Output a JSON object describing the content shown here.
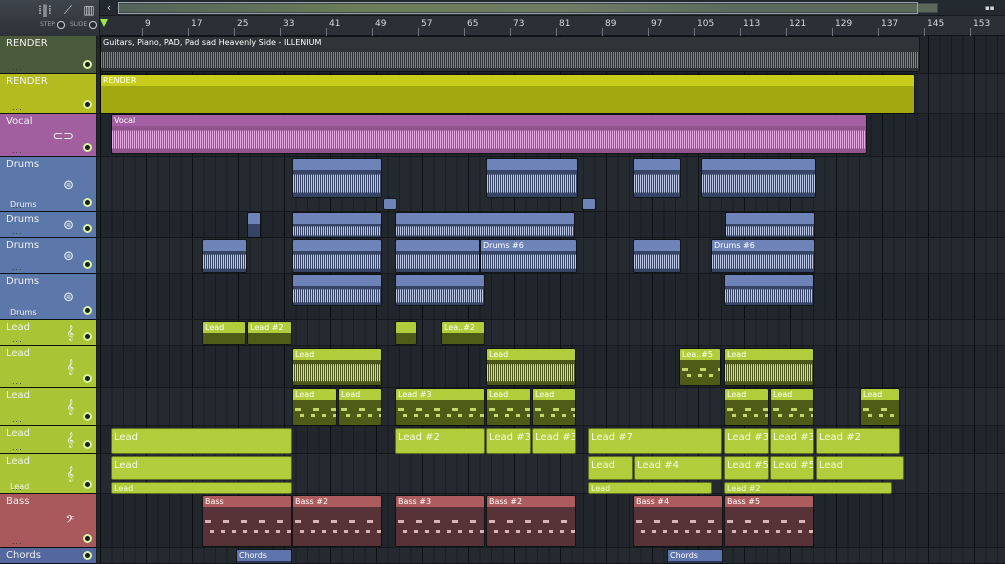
{
  "toolbar": {
    "step_label": "STEP",
    "slide_label": "SLIDE"
  },
  "ruler": {
    "ticks": [
      "9",
      "17",
      "25",
      "33",
      "41",
      "49",
      "57",
      "65",
      "73",
      "81",
      "89",
      "97",
      "105",
      "113",
      "121",
      "129",
      "137",
      "145",
      "153"
    ]
  },
  "tracks": [
    {
      "id": "render1",
      "label": "RENDER",
      "style": "render1"
    },
    {
      "id": "render2",
      "label": "RENDER",
      "style": "render2"
    },
    {
      "id": "vocal",
      "label": "Vocal",
      "style": "vocal",
      "icon": "lips-icon"
    },
    {
      "id": "drums1",
      "label": "Drums",
      "style": "drums",
      "icon": "drum-icon",
      "sub": "Drums"
    },
    {
      "id": "drums2",
      "label": "Drums",
      "style": "drums",
      "icon": "drum-icon"
    },
    {
      "id": "drums3",
      "label": "Drums",
      "style": "drums",
      "icon": "drum-icon"
    },
    {
      "id": "drums4",
      "label": "Drums",
      "style": "drums",
      "icon": "drum-icon",
      "sub": "Drums"
    },
    {
      "id": "lead1",
      "label": "Lead",
      "style": "lead",
      "icon": "treble-clef-icon"
    },
    {
      "id": "lead2",
      "label": "Lead",
      "style": "lead",
      "icon": "treble-clef-icon"
    },
    {
      "id": "lead3",
      "label": "Lead",
      "style": "lead",
      "icon": "treble-clef-icon"
    },
    {
      "id": "lead4",
      "label": "Lead",
      "style": "lead",
      "icon": "treble-clef-icon"
    },
    {
      "id": "lead5",
      "label": "Lead",
      "style": "lead",
      "icon": "treble-clef-icon",
      "sub": "Lead"
    },
    {
      "id": "bass",
      "label": "Bass",
      "style": "bass",
      "icon": "bass-clef-icon"
    },
    {
      "id": "chords",
      "label": "Chords",
      "style": "chords"
    }
  ],
  "clips": {
    "render_audio": "Guitars, Piano, PAD, Pad sad Heavenly Side - ILLENIUM",
    "render_pattern": "RENDER",
    "vocal": "Vocal",
    "drums6a": "Drums #6",
    "drums6b": "Drums #6",
    "lead": "Lead",
    "lead2": "Lead #2",
    "lea2": "Lea..#2",
    "lea5": "Lea..#5",
    "lead3": "Lead #3",
    "lead7": "Lead #7",
    "lead4": "Lead #4",
    "lead5": "Lead #5",
    "bass": "Bass",
    "bass2": "Bass #2",
    "bass3": "Bass #3",
    "bass4": "Bass #4",
    "bass5": "Bass #5",
    "chords": "Chords"
  }
}
